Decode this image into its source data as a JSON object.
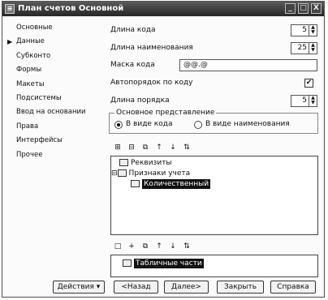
{
  "window": {
    "title": "План счетов Основной",
    "icon": "chart-of-accounts-icon",
    "controls": [
      "_",
      "□",
      "X"
    ]
  },
  "sidebar": {
    "items": [
      {
        "label": "Основные",
        "active": false
      },
      {
        "label": "Данные",
        "active": true
      },
      {
        "label": "Субконто",
        "active": false
      },
      {
        "label": "Формы",
        "active": false
      },
      {
        "label": "Макеты",
        "active": false
      },
      {
        "label": "Подсистемы",
        "active": false
      },
      {
        "label": "Ввод на основании",
        "active": false
      },
      {
        "label": "Права",
        "active": false
      },
      {
        "label": "Интерфейсы",
        "active": false
      },
      {
        "label": "Прочее",
        "active": false
      }
    ]
  },
  "fields": {
    "code_length": {
      "label": "Длина кода",
      "value": "5"
    },
    "name_length": {
      "label": "Длина наименования",
      "value": "25"
    },
    "code_mask": {
      "label": "Маска кода",
      "value": "@@.@"
    },
    "auto_order": {
      "label": "Автопорядок по коду",
      "checked": true,
      "mark": "✔"
    },
    "order_length": {
      "label": "Длина порядка",
      "value": "5"
    }
  },
  "representation": {
    "legend": "Основное представление",
    "options": [
      {
        "label": "В виде кода",
        "selected": true
      },
      {
        "label": "В виде наименования",
        "selected": false
      }
    ]
  },
  "toolbar1": {
    "icons": [
      "add-icon",
      "add-child-icon",
      "copy-icon",
      "move-up-icon",
      "move-down-icon",
      "sort-icon"
    ],
    "glyphs": [
      "⊞",
      "⊟",
      "⧉",
      "↑",
      "↓",
      "⇅"
    ]
  },
  "tree1": {
    "nodes": [
      {
        "label": "Реквизиты",
        "level": 0,
        "expander": ""
      },
      {
        "label": "Признаки учета",
        "level": 0,
        "expander": "⊟"
      },
      {
        "label": "Количественный",
        "level": 1,
        "expander": "",
        "selected": true
      }
    ]
  },
  "toolbar2": {
    "icons": [
      "add-icon",
      "add-child-icon",
      "copy-icon",
      "move-up-icon",
      "move-down-icon",
      "sort-icon"
    ],
    "glyphs": [
      "□",
      "+",
      "⧉",
      "↑",
      "↓",
      "⇅"
    ]
  },
  "tree2": {
    "nodes": [
      {
        "label": "Табличные части",
        "level": 0,
        "expander": "",
        "selected": true
      }
    ]
  },
  "buttons": {
    "actions": "Действия ▾",
    "back": "<Назад",
    "next": "Далее>",
    "close": "Закрыть",
    "help": "Справка"
  }
}
